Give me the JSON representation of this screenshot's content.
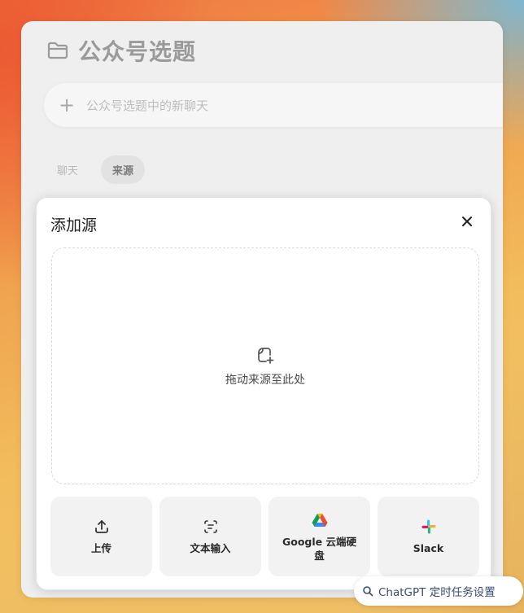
{
  "project": {
    "title": "公众号选题",
    "new_chat_placeholder": "公众号选题中的新聊天",
    "tabs": [
      {
        "label": "聊天",
        "active": false
      },
      {
        "label": "来源",
        "active": true
      }
    ]
  },
  "modal": {
    "title": "添加源",
    "dropzone_text": "拖动来源至此处",
    "sources": [
      {
        "label": "上传",
        "icon": "upload-icon"
      },
      {
        "label": "文本输入",
        "icon": "text-input-icon"
      },
      {
        "label": "Google 云端硬盘",
        "icon": "google-drive-icon"
      },
      {
        "label": "Slack",
        "icon": "slack-icon"
      }
    ]
  },
  "badge": {
    "text": "ChatGPT 定时任务设置",
    "icon": "search-icon"
  },
  "colors": {
    "panel_bg": "#efefef",
    "modal_bg": "#ffffff",
    "source_btn_bg": "#f2f2f2",
    "badge_text": "#3a4a74"
  }
}
